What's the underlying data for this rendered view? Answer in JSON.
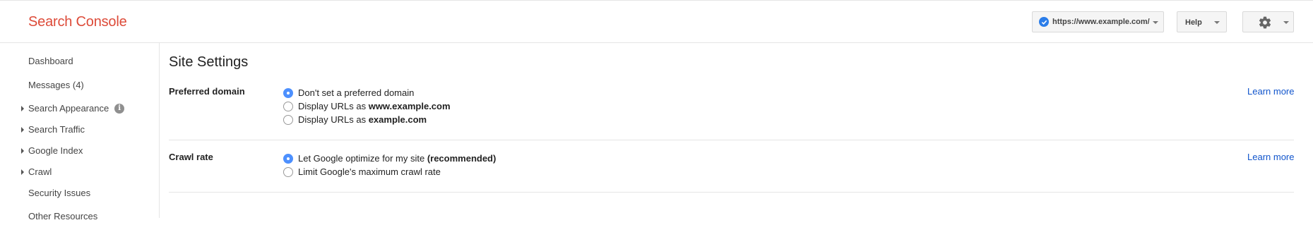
{
  "header": {
    "brand": "Search Console",
    "property_url": "https://www.example.com/",
    "help_label": "Help"
  },
  "sidebar": {
    "items": [
      {
        "label": "Dashboard"
      },
      {
        "label": "Messages (4)"
      },
      {
        "label": "Search Appearance"
      },
      {
        "label": "Search Traffic"
      },
      {
        "label": "Google Index"
      },
      {
        "label": "Crawl"
      },
      {
        "label": "Security Issues"
      },
      {
        "label": "Other Resources"
      }
    ],
    "info_glyph": "i"
  },
  "main": {
    "title": "Site Settings",
    "preferred_domain": {
      "label": "Preferred domain",
      "options": [
        {
          "prefix": "Don't set a preferred domain",
          "bold": "",
          "suffix": "",
          "selected": true
        },
        {
          "prefix": "Display URLs as ",
          "bold": "www.example.com",
          "suffix": "",
          "selected": false
        },
        {
          "prefix": "Display URLs as ",
          "bold": "example.com",
          "suffix": "",
          "selected": false
        }
      ],
      "learn_more": "Learn more"
    },
    "crawl_rate": {
      "label": "Crawl rate",
      "options": [
        {
          "prefix": "Let Google optimize for my site ",
          "bold": "(recommended)",
          "suffix": "",
          "selected": true
        },
        {
          "prefix": "Limit Google's maximum crawl rate",
          "bold": "",
          "suffix": "",
          "selected": false
        }
      ],
      "learn_more": "Learn more"
    }
  },
  "colors": {
    "brand": "#dd4b39",
    "link": "#1155cc",
    "radio_selected": "#4d90fe",
    "verified": "#2b7de9"
  }
}
